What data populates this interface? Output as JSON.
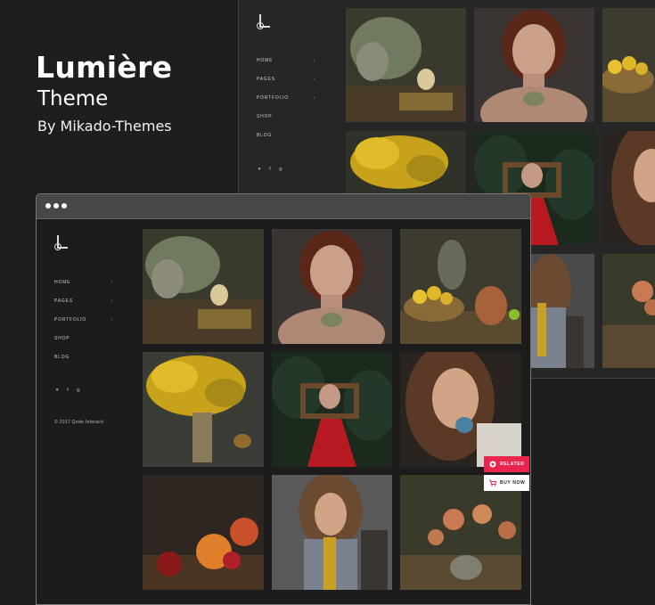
{
  "brand": {
    "title": "Lumière",
    "subtitle": "Theme",
    "byline": "By Mikado-Themes"
  },
  "nav": {
    "items": [
      {
        "label": "HOME",
        "arrow": "›"
      },
      {
        "label": "PAGES",
        "arrow": "›"
      },
      {
        "label": "PORTFOLIO",
        "arrow": "›"
      },
      {
        "label": "SHOP",
        "arrow": ""
      },
      {
        "label": "BLOG",
        "arrow": ""
      }
    ],
    "social": [
      "twitter-icon",
      "facebook-icon",
      "instagram-icon"
    ],
    "social_glyphs": [
      "🐦",
      "f",
      "◎"
    ],
    "copyright": "© 2017 Qode Interacti"
  },
  "buttons": {
    "related": "RELATED",
    "buy": "BUY NOW"
  },
  "colors": {
    "accent": "#e8244f",
    "background": "#1e1e1e"
  }
}
